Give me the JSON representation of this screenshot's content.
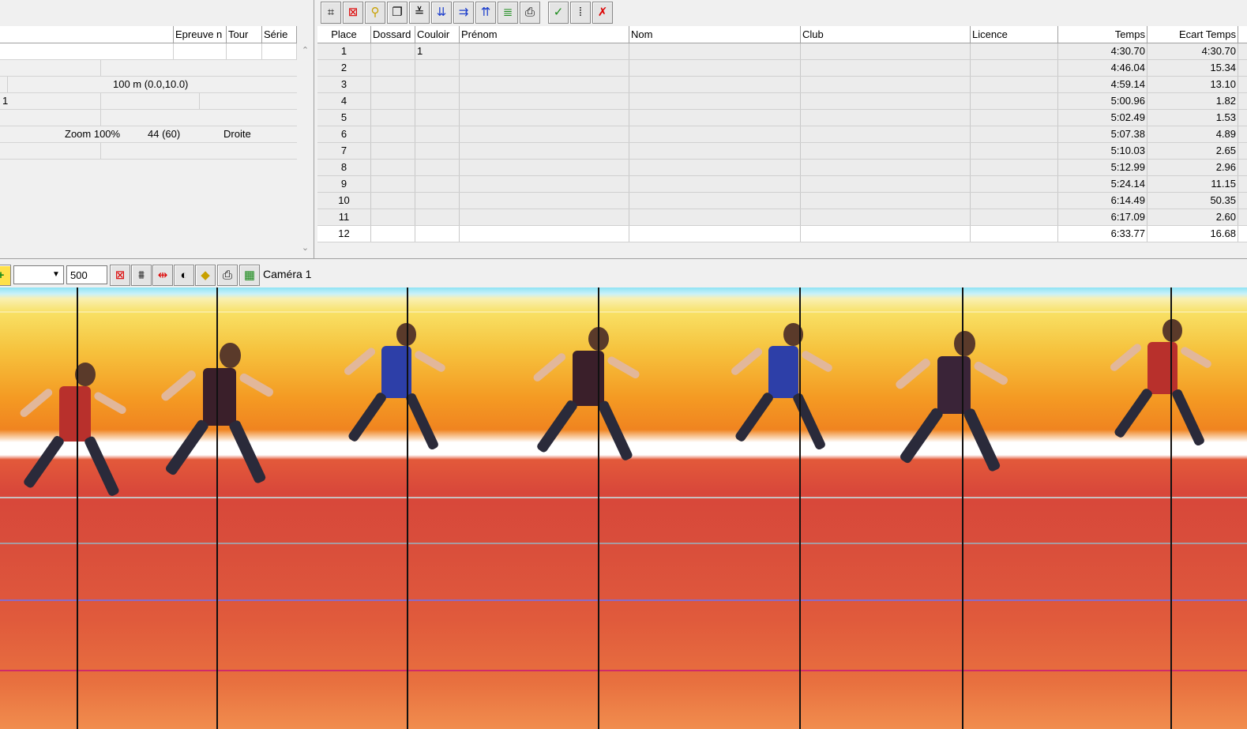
{
  "left_panel": {
    "columns": [
      "Epreuve n",
      "Tour",
      "Série"
    ],
    "info": {
      "distance": "100 m (0.0,10.0)",
      "lane_value": "1",
      "zoom": "Zoom 100%",
      "frames": "44  (60)",
      "direction": "Droite"
    }
  },
  "results": {
    "toolbar_icons": [
      "select-area-icon",
      "delete-area-icon",
      "zoom-icon",
      "copy-window-icon",
      "check-list-icon",
      "import-icon",
      "import-list-icon",
      "export-icon",
      "ranking-icon",
      "print-icon",
      "validate-icon",
      "split-icon",
      "cancel-icon"
    ],
    "columns": [
      "Place",
      "Dossard",
      "Couloir",
      "Prénom",
      "Nom",
      "Club",
      "Licence",
      "Temps",
      "Ecart Temps"
    ],
    "rows": [
      {
        "place": "1",
        "dossard": "",
        "couloir": "1",
        "prenom": "",
        "nom": "",
        "club": "",
        "licence": "",
        "temps": "4:30.70",
        "ecart": "4:30.70"
      },
      {
        "place": "2",
        "dossard": "",
        "couloir": "",
        "prenom": "",
        "nom": "",
        "club": "",
        "licence": "",
        "temps": "4:46.04",
        "ecart": "15.34"
      },
      {
        "place": "3",
        "dossard": "",
        "couloir": "",
        "prenom": "",
        "nom": "",
        "club": "",
        "licence": "",
        "temps": "4:59.14",
        "ecart": "13.10"
      },
      {
        "place": "4",
        "dossard": "",
        "couloir": "",
        "prenom": "",
        "nom": "",
        "club": "",
        "licence": "",
        "temps": "5:00.96",
        "ecart": "1.82"
      },
      {
        "place": "5",
        "dossard": "",
        "couloir": "",
        "prenom": "",
        "nom": "",
        "club": "",
        "licence": "",
        "temps": "5:02.49",
        "ecart": "1.53"
      },
      {
        "place": "6",
        "dossard": "",
        "couloir": "",
        "prenom": "",
        "nom": "",
        "club": "",
        "licence": "",
        "temps": "5:07.38",
        "ecart": "4.89"
      },
      {
        "place": "7",
        "dossard": "",
        "couloir": "",
        "prenom": "",
        "nom": "",
        "club": "",
        "licence": "",
        "temps": "5:10.03",
        "ecart": "2.65"
      },
      {
        "place": "8",
        "dossard": "",
        "couloir": "",
        "prenom": "",
        "nom": "",
        "club": "",
        "licence": "",
        "temps": "5:12.99",
        "ecart": "2.96"
      },
      {
        "place": "9",
        "dossard": "",
        "couloir": "",
        "prenom": "",
        "nom": "",
        "club": "",
        "licence": "",
        "temps": "5:24.14",
        "ecart": "11.15"
      },
      {
        "place": "10",
        "dossard": "",
        "couloir": "",
        "prenom": "",
        "nom": "",
        "club": "",
        "licence": "",
        "temps": "6:14.49",
        "ecart": "50.35"
      },
      {
        "place": "11",
        "dossard": "",
        "couloir": "",
        "prenom": "",
        "nom": "",
        "club": "",
        "licence": "",
        "temps": "6:17.09",
        "ecart": "2.60"
      },
      {
        "place": "12",
        "dossard": "",
        "couloir": "",
        "prenom": "",
        "nom": "",
        "club": "",
        "licence": "",
        "temps": "6:33.77",
        "ecart": "16.68"
      }
    ]
  },
  "camera_toolbar": {
    "lane_select_value": "",
    "speed_value": "500",
    "camera_label": "Caméra 1",
    "icons": [
      "add-icon",
      "delete-line-icon",
      "adjust-icon",
      "align-lines-icon",
      "contrast-icon",
      "marker-icon",
      "print-icon",
      "grid-icon"
    ]
  },
  "photo_finish": {
    "runner_colors": [
      "#b8302c",
      "#3a1f2a",
      "#2d3fa8",
      "#3a1f2a",
      "#2d3fa8",
      "#3a2438",
      "#b8302c"
    ]
  }
}
